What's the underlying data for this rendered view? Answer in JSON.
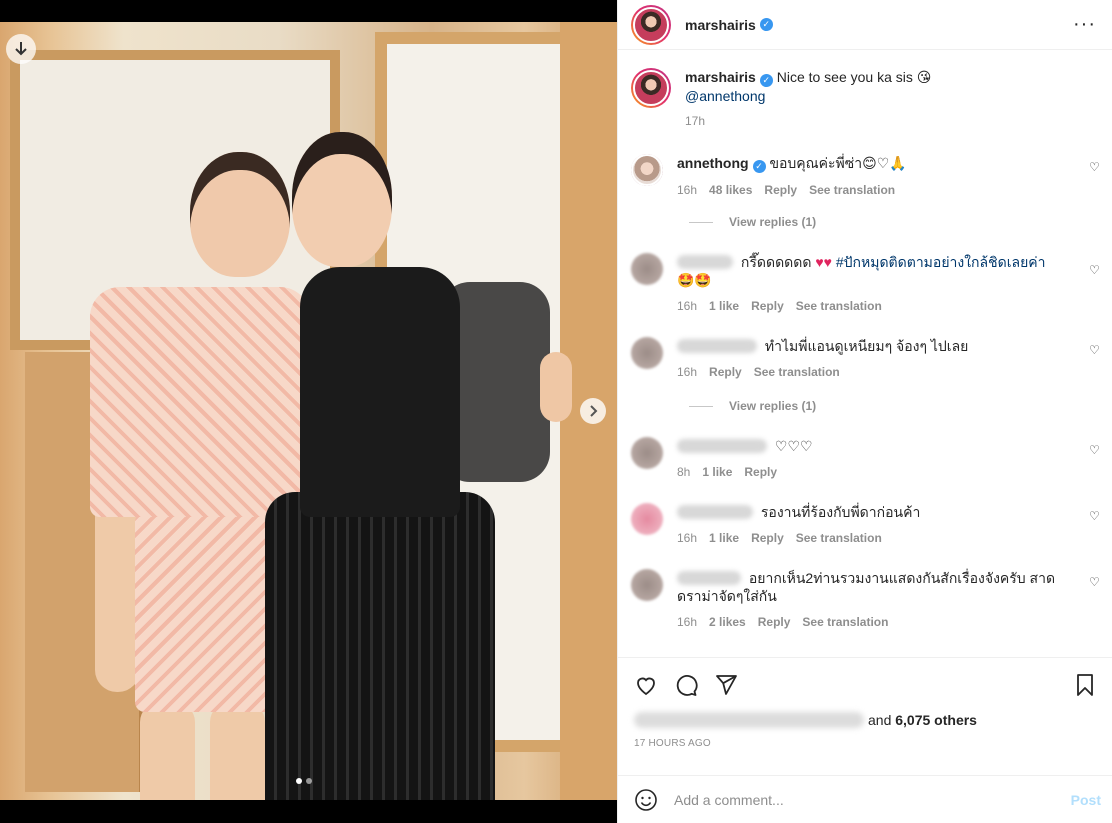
{
  "post": {
    "author": "marshairis",
    "caption_text": "Nice to see you ka sis 😘",
    "caption_mention": "@annethong",
    "caption_time": "17h",
    "carousel_position": 1,
    "carousel_total": 2
  },
  "comments": [
    {
      "user": "annethong",
      "verified": true,
      "text": "ขอบคุณค่ะพี่ซ่า😊♡🙏",
      "time": "16h",
      "likes": "48 likes",
      "reply": "Reply",
      "translate": "See translation",
      "view_replies": "View replies (1)"
    },
    {
      "text_main": "กรี๊ดดดดดด",
      "text_hearts": "♥♥",
      "text_hashtag": "#ปักหมุดติดตามอย่างใกล้ชิดเลยค่า",
      "text_emoji": "🤩🤩",
      "time": "16h",
      "likes": "1 like",
      "reply": "Reply",
      "translate": "See translation"
    },
    {
      "text": "ทำไมพี่แอนดูเหนียมๆ จ้องๆ ไปเลย",
      "time": "16h",
      "reply": "Reply",
      "translate": "See translation",
      "view_replies": "View replies (1)"
    },
    {
      "text": "♡♡♡",
      "time": "8h",
      "likes": "1 like",
      "reply": "Reply"
    },
    {
      "text": "รองานที่ร้องกับพี่ดาก่อนค้า",
      "time": "16h",
      "likes": "1 like",
      "reply": "Reply",
      "translate": "See translation"
    },
    {
      "text_line1": "อยากเห็น2ท่านรวมงานแสดงกันสักเรื่องจังครับ สาด",
      "text_line2": "ดราม่าจัดๆใส่กัน",
      "time": "16h",
      "likes": "2 likes",
      "reply": "Reply",
      "translate": "See translation"
    }
  ],
  "likes_summary": {
    "prefix": "and",
    "count_text": "6,075 others"
  },
  "posted_ago": "17 HOURS AGO",
  "composer": {
    "placeholder": "Add a comment...",
    "post_label": "Post"
  },
  "icons": {
    "download": "download-icon",
    "next": "chevron-right-icon",
    "more": "more-horizontal-icon",
    "like": "heart-icon",
    "comment": "comment-icon",
    "share": "share-icon",
    "save": "bookmark-icon",
    "emoji": "emoji-icon"
  },
  "colors": {
    "verified": "#3897f0",
    "mention": "#00376b",
    "post_disabled": "#b2dffc",
    "heart_red": "#e0245e"
  }
}
